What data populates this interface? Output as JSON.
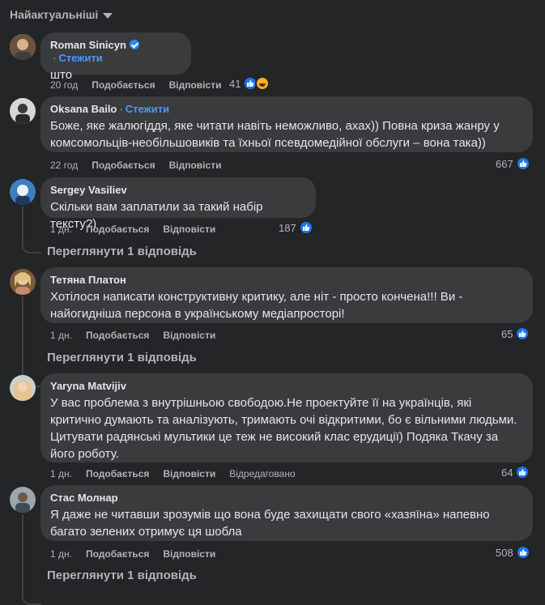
{
  "sort": {
    "label": "Найактуальніші"
  },
  "comments": [
    {
      "author": "Roman Sinicyn",
      "verified": true,
      "follow": "Стежити",
      "text": "што",
      "time": "20 год",
      "like": "Подобається",
      "reply": "Відповісти",
      "count": "41",
      "reactions": [
        "like",
        "haha"
      ],
      "avatar_color": "#c9a98a"
    },
    {
      "author": "Oksana Bailo",
      "verified": false,
      "follow": "Стежити",
      "text": "Боже, яке жалюгіддя, яке читати навіть неможливо, ахах)) Повна криза жанру у комсомольців-необільшовиків та їхньої псевдомедійної обслуги – вона така))",
      "time": "22 год",
      "like": "Подобається",
      "reply": "Відповісти",
      "count": "667",
      "reactions": [
        "like"
      ],
      "avatar_color": "#8a8f95"
    },
    {
      "author": "Sergey Vasiliev",
      "text": "Скільки вам заплатили за такий набір тексту?)",
      "time": "1 дн.",
      "like": "Подобається",
      "reply": "Відповісти",
      "count": "187",
      "reactions": [
        "like"
      ],
      "view_replies": "Переглянути 1 відповідь",
      "avatar_color": "#4a86c5"
    },
    {
      "author": "Тетяна Платон",
      "text": "Хотілося написати конструктивну критику, але ніт - просто кончена!!! Ви - найогидніша персона в українському медіапросторі!",
      "time": "1 дн.",
      "like": "Подобається",
      "reply": "Відповісти",
      "count": "65",
      "reactions": [
        "like"
      ],
      "view_replies": "Переглянути 1 відповідь",
      "avatar_color": "#d9b48a"
    },
    {
      "author": "Yaryna Matvijiv",
      "text": "У вас проблема з внутрішньою свободою.Не проектуйте її на українців, які критично думають та аналізують, тримають очі відкритими, бо є вільними людьми. Цитувати радянські мультики це теж не високий клас ерудиції) Подяка Ткачу за його роботу.",
      "time": "1 дн.",
      "like": "Подобається",
      "reply": "Відповісти",
      "edited": "Відредаговано",
      "count": "64",
      "reactions": [
        "like"
      ],
      "avatar_color": "#e0c29a"
    },
    {
      "author": "Стас Молнар",
      "text": "Я даже не читавши зрозумів що вона буде захищати свого «хазяїна» напевно багато зелених отримує ця шобла",
      "time": "1 дн.",
      "like": "Подобається",
      "reply": "Відповісти",
      "count": "508",
      "reactions": [
        "like"
      ],
      "view_replies": "Переглянути 1 відповідь",
      "avatar_color": "#7b8a90"
    }
  ]
}
